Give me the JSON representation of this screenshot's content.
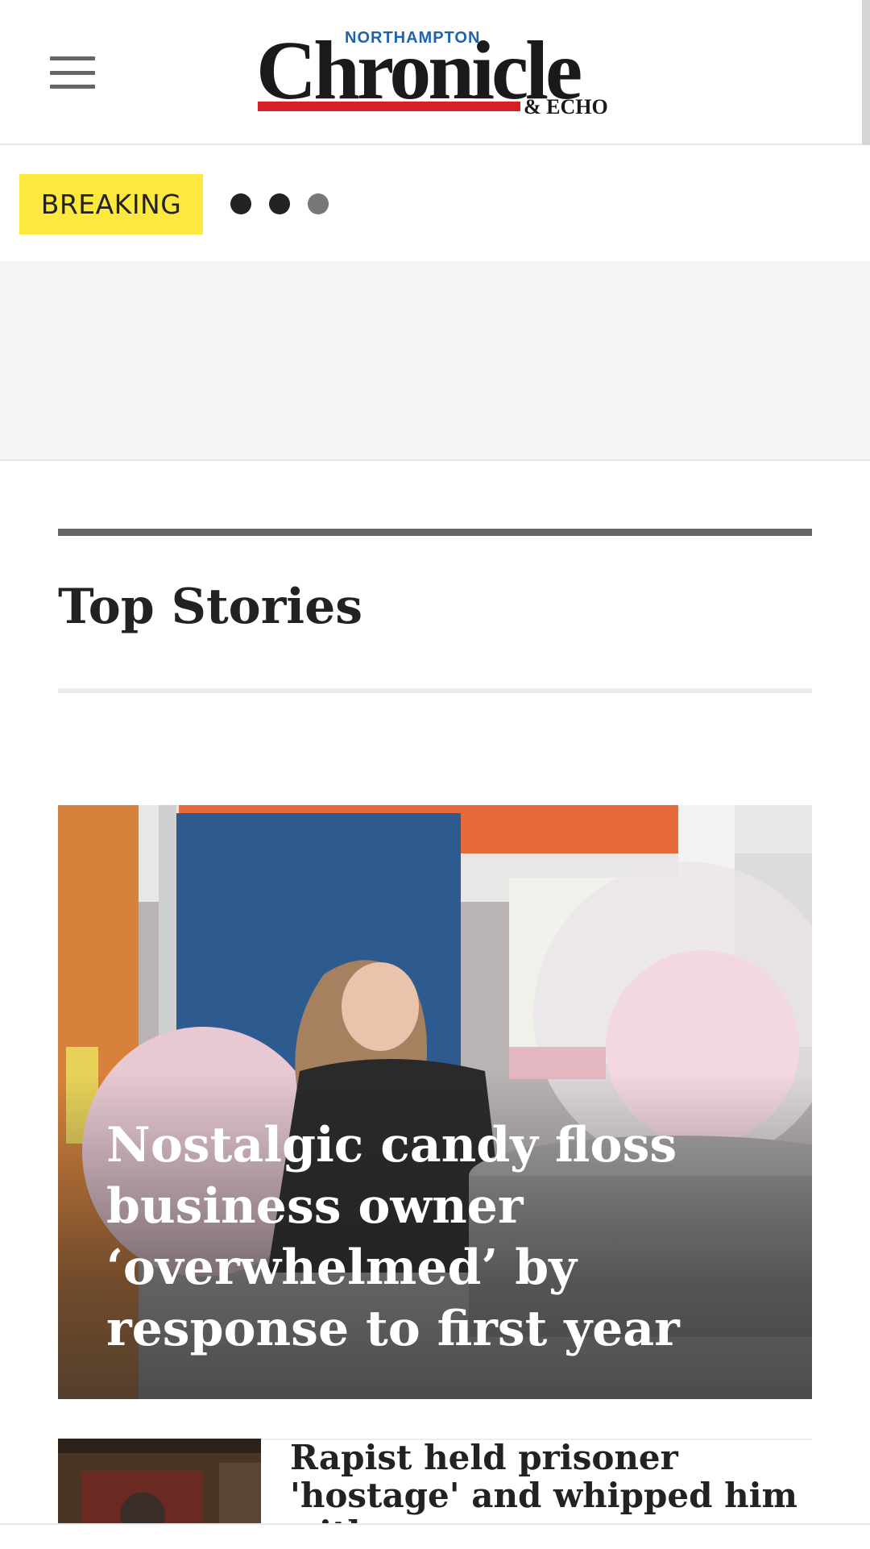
{
  "header": {
    "menu_icon": "hamburger-menu-icon",
    "logo": {
      "top_text": "NORTHAMPTON",
      "main_text": "Chronicle",
      "sub_text": "& ECHO",
      "brand_red": "#d71f26",
      "brand_blue": "#1e63b0"
    }
  },
  "breaking": {
    "label": "BREAKING",
    "badge_color": "#fde840",
    "carousel_dots": 3
  },
  "top_stories": {
    "title": "Top Stories",
    "hero": {
      "headline": "Nostalgic candy floss business owner ‘overwhelmed’ by response to first year"
    },
    "items": [
      {
        "headline": "Rapist held prisoner 'hostage' and whipped him with power"
      }
    ]
  }
}
